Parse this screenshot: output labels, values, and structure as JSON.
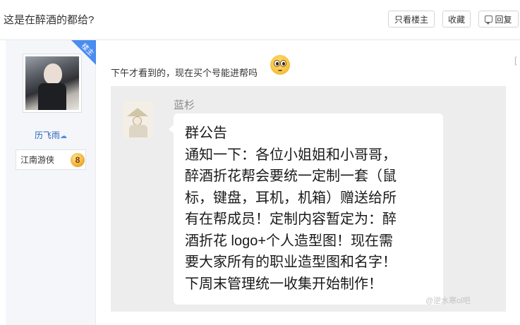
{
  "header": {
    "title": "这是在醉酒的都给?",
    "btn_only_owner": "只看楼主",
    "btn_favorite": "收藏",
    "btn_reply": "回复"
  },
  "author": {
    "owner_badge": "楼主",
    "name": "历飞雨",
    "level_name": "江南游侠",
    "level": "8"
  },
  "post": {
    "text": "下午才看到的，现在买个号能进帮吗",
    "cut_text": "[",
    "screenshot": {
      "sender": "蓝杉",
      "lines": [
        "群公告",
        "通知一下：各位小姐姐和小哥哥，",
        "醉酒折花帮会要统一定制一套（鼠",
        "标，键盘，耳机，机箱）赠送给所",
        "有在帮成员！定制内容暂定为：醉",
        "酒折花 logo+个人造型图！现在需",
        "要大家所有的职业造型图和名字！",
        "下周末管理统一收集开始制作！"
      ],
      "watermark": "@逆水寒ol吧"
    }
  },
  "colors": {
    "accent_blue": "#4a8cf0",
    "author_name": "#2d64b3"
  }
}
